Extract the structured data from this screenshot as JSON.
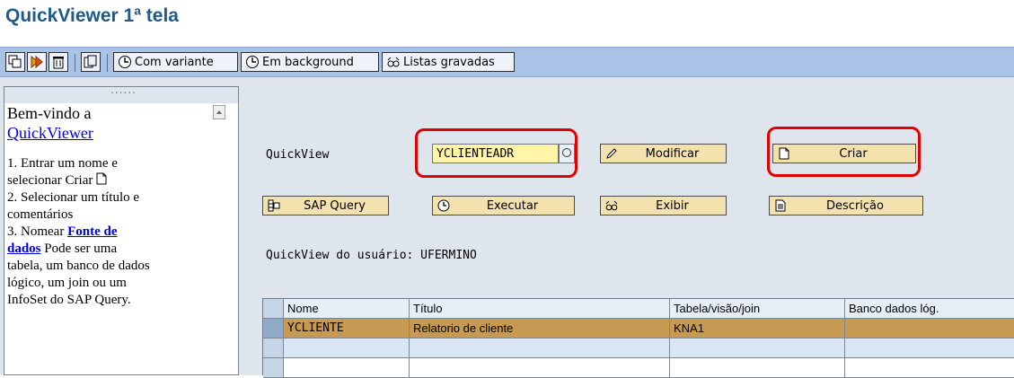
{
  "window": {
    "title": "QuickViewer 1ª tela"
  },
  "toolbar": {
    "com_variante": "Com variante",
    "em_background": "Em background",
    "listas_gravadas": "Listas gravadas"
  },
  "help_panel": {
    "handle": "......",
    "lines": [
      "Bem-vindo a",
      "QuickViewer",
      "",
      "1. Entrar um nome e",
      "selecionar Criar",
      "2. Selecionar um título e",
      "comentários",
      "3. Nomear ",
      "Fonte de",
      "dados",
      " Pode ser uma",
      "tabela, um banco de dados",
      "lógico, um join ou um",
      "InfoSet do SAP Query."
    ]
  },
  "form": {
    "quickview_label": "QuickView",
    "quickview_value": "YCLIENTEADR",
    "modificar": "Modificar",
    "criar": "Criar",
    "sap_query": "SAP Query",
    "executar": "Executar",
    "exibir": "Exibir",
    "descricao": "Descrição",
    "user_label": "QuickView do usuário: UFERMINO"
  },
  "grid": {
    "columns": [
      "Nome",
      "Título",
      "Tabela/visão/join",
      "Banco dados lóg."
    ],
    "rows": [
      [
        "YCLIENTE",
        "Relatorio de cliente",
        "KNA1",
        ""
      ]
    ]
  },
  "colors": {
    "title": "#1e5a8c",
    "toolbar": "#a9c2e6",
    "button": "#f3e2ad",
    "highlight_frame": "#e00000",
    "selected_row": "#c69a50"
  }
}
